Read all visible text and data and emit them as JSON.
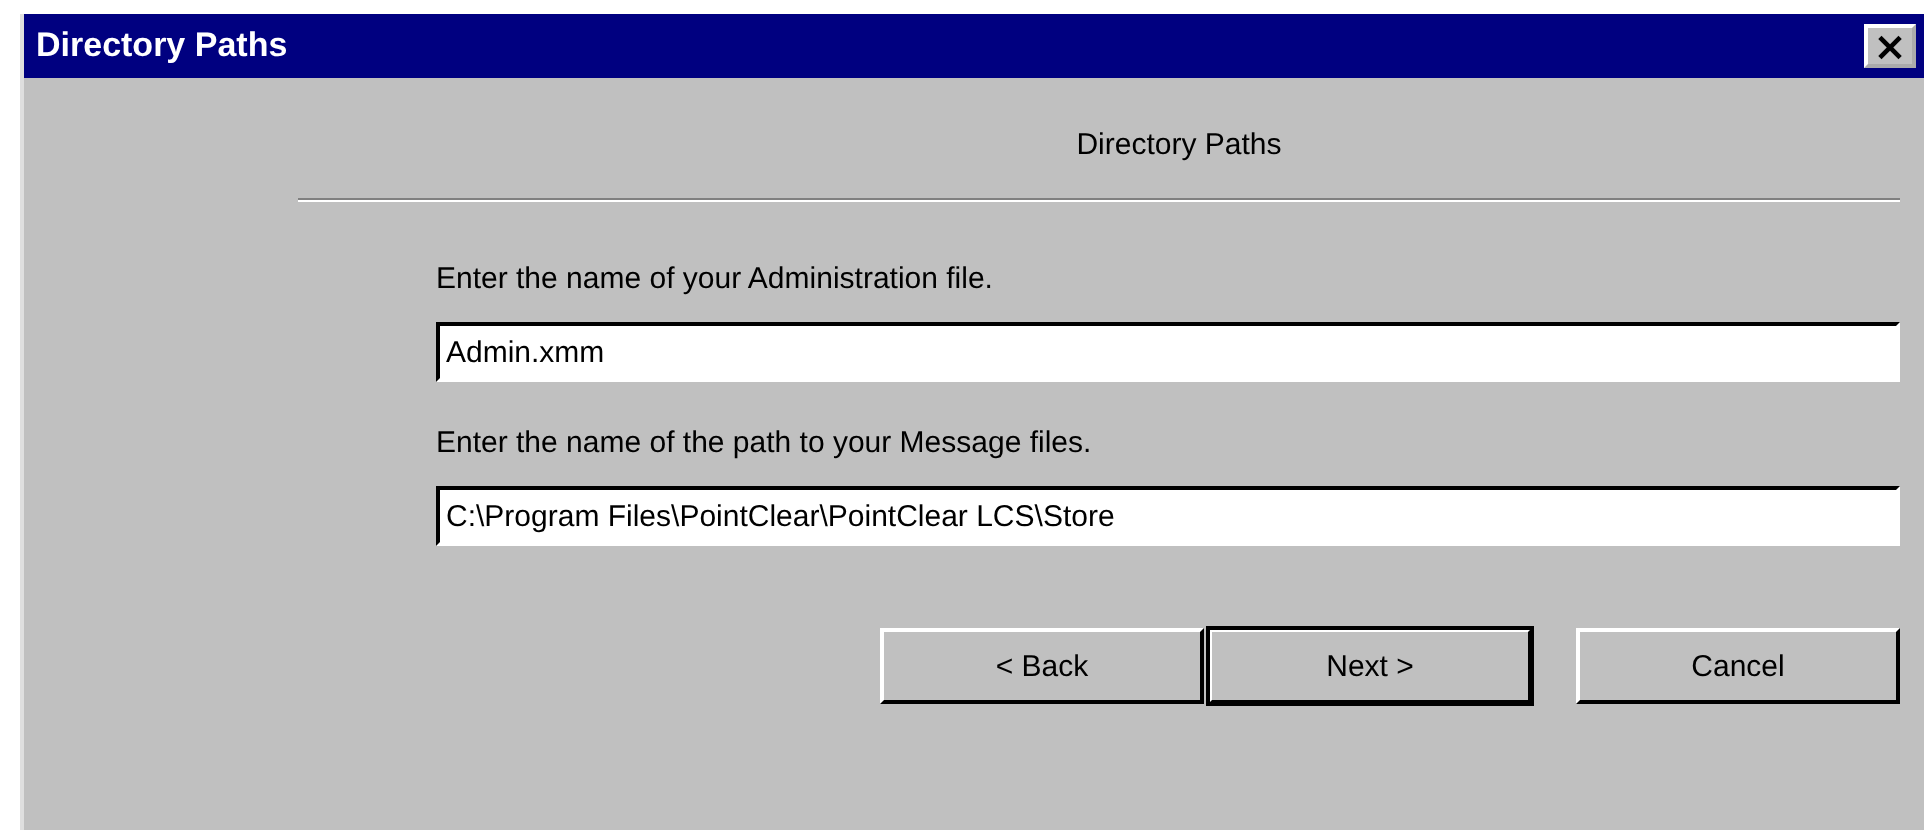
{
  "window": {
    "title": "Directory Paths",
    "close": "×"
  },
  "header": "Directory Paths",
  "fields": [
    {
      "label": "Enter the name of your Administration file.",
      "value": "Admin.xmm"
    },
    {
      "label": "Enter the name of the path to your Message files.",
      "value": "C:\\Program Files\\PointClear\\PointClear LCS\\Store"
    }
  ],
  "buttons": [
    {
      "label": "< Back",
      "default": false
    },
    {
      "label": "Next >",
      "default": true
    },
    {
      "label": "Cancel",
      "default": false
    }
  ]
}
